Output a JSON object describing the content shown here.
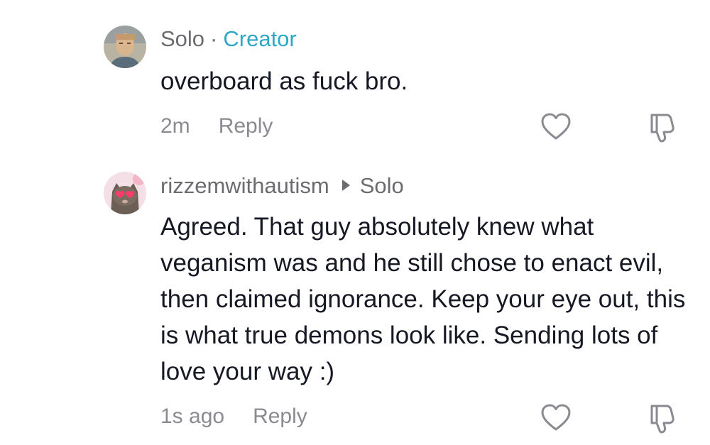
{
  "comments": [
    {
      "username": "Solo",
      "separator": "·",
      "badge": "Creator",
      "text": "overboard as fuck bro.",
      "time": "2m",
      "reply_label": "Reply"
    },
    {
      "username": "rizzemwithautism",
      "reply_to": "Solo",
      "text": "Agreed. That guy absolutely knew what veganism was and he still chose to enact evil, then claimed ignorance. Keep your eye out, this is what true demons look like. Sending lots of love your way :)",
      "time": "1s ago",
      "reply_label": "Reply"
    }
  ],
  "colors": {
    "creator_badge": "#2ea7c7",
    "username": "#6b6b70",
    "secondary_text": "#8a8b91",
    "body_text": "#161823"
  },
  "icons": [
    "heart-icon",
    "dislike-icon",
    "reply-arrow-icon"
  ]
}
